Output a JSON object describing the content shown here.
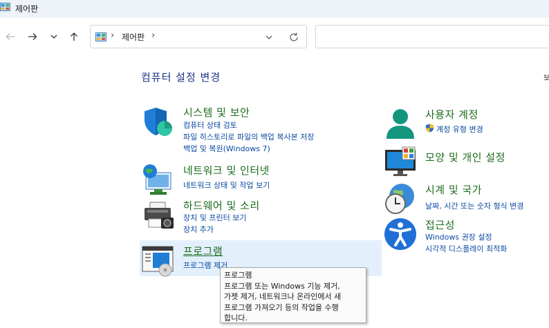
{
  "window": {
    "title": "제어판",
    "icon": "control-panel-icon"
  },
  "navigation": {
    "back_icon": "back-arrow-icon",
    "forward_icon": "forward-arrow-icon",
    "recent_icon": "chevron-down-icon",
    "up_icon": "up-arrow-icon",
    "address": {
      "sep1": "›",
      "crumb": "제어판",
      "sep2": "›"
    },
    "search": {
      "value": "",
      "placeholder": ""
    }
  },
  "page": {
    "title": "컴퓨터 설정 변경",
    "view_by": "보"
  },
  "categories_left": [
    {
      "title": "시스템 및 보안",
      "icon": "shield-icon",
      "links": [
        "컴퓨터 상태 검토",
        "파일 히스토리로 파일의 백업 복사본 저장",
        "백업 및 복원(Windows 7)"
      ]
    },
    {
      "title": "네트워크 및 인터넷",
      "icon": "network-globe-icon",
      "links": [
        "네트워크 상태 및 작업 보기"
      ]
    },
    {
      "title": "하드웨어 및 소리",
      "icon": "printer-icon",
      "links": [
        "장치 및 프린터 보기",
        "장치 추가"
      ]
    },
    {
      "title": "프로그램",
      "icon": "programs-icon",
      "links": [
        "프로그램 제거"
      ]
    }
  ],
  "categories_right": [
    {
      "title": "사용자 계정",
      "icon": "user-icon",
      "links": [
        "계정 유형 변경"
      ]
    },
    {
      "title": "모양 및 개인 설정",
      "icon": "monitor-icon",
      "links": []
    },
    {
      "title": "시계 및 국가",
      "icon": "clock-globe-icon",
      "links": [
        "날짜, 시간 또는 숫자 형식 변경"
      ]
    },
    {
      "title": "접근성",
      "icon": "accessibility-icon",
      "links": [
        "Windows 권장 설정",
        "시각적 디스플레이 최적화"
      ]
    }
  ],
  "tooltip": {
    "lines": [
      "프로그램",
      "프로그램 또는 Windows 기능 제거,",
      "가젯 제거, 네트워크나 온라인에서 새",
      "프로그램 가져오기 등의 작업을 수행",
      "합니다."
    ]
  },
  "colors": {
    "link": "#0b4aa3",
    "category_title": "#1c6b1c",
    "page_title": "#1e3287",
    "hover": "#e3f0fc"
  }
}
